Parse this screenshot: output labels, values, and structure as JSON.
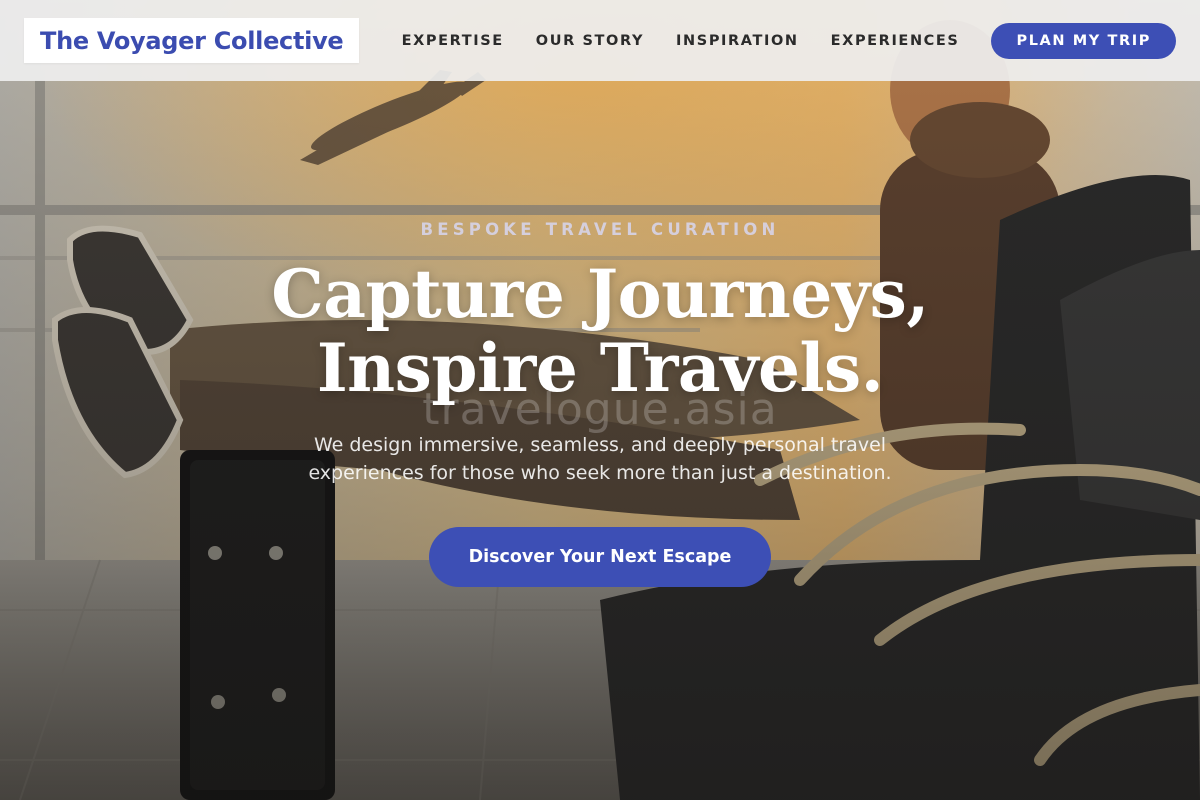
{
  "brand": {
    "logo_text": "The Voyager Collective",
    "accent": "#3d4fb5"
  },
  "nav": {
    "items": [
      {
        "label": "EXPERTISE"
      },
      {
        "label": "OUR STORY"
      },
      {
        "label": "INSPIRATION"
      },
      {
        "label": "EXPERIENCES"
      }
    ],
    "cta_label": "PLAN MY TRIP"
  },
  "hero": {
    "eyebrow": "BESPOKE TRAVEL CURATION",
    "headline_line1": "Capture Journeys,",
    "headline_line2": "Inspire Travels.",
    "watermark": "travelogue.asia",
    "subtext": "We design immersive, seamless, and deeply personal travel experiences for those who seek more than just a destination.",
    "cta_label": "Discover Your Next Escape"
  }
}
